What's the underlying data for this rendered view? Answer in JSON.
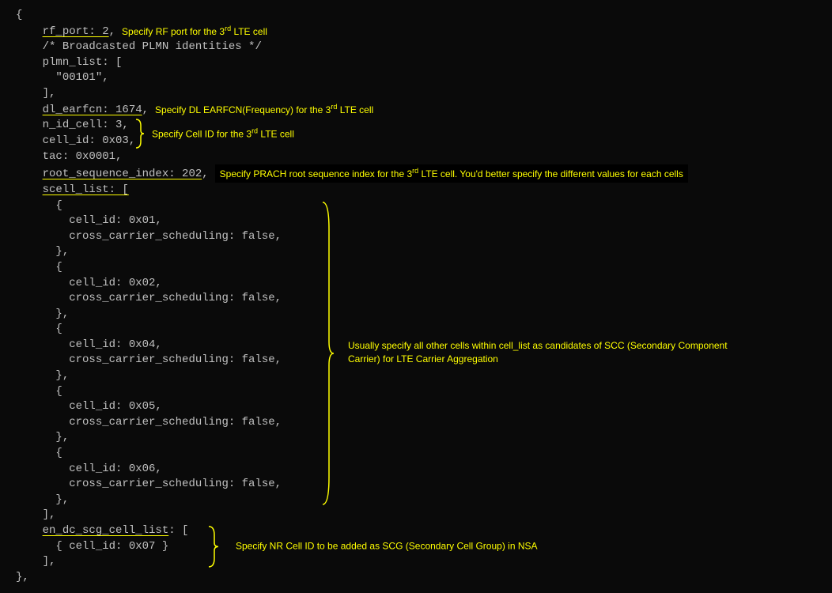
{
  "code": {
    "open_brace": "{",
    "rf_port_key": "rf_port: 2",
    "rf_port_comma": ",",
    "plmn_comment": "/* Broadcasted PLMN identities */",
    "plmn_list_open": "plmn_list: [",
    "plmn_value": "\"00101\",",
    "plmn_list_close": "],",
    "dl_earfcn_key": "dl_earfcn: 1674",
    "dl_earfcn_comma": ",",
    "n_id_cell": "n_id_cell: 3,",
    "cell_id": "cell_id: 0x03,",
    "tac": "tac: 0x0001,",
    "root_seq_key": "root_sequence_index: 202",
    "root_seq_comma": ",",
    "scell_open": "scell_list: [",
    "scell_item_open": "{",
    "scell_cellid_1": "cell_id: 0x01,",
    "scell_ccs": "cross_carrier_scheduling: false,",
    "scell_item_close": "},",
    "scell_cellid_2": "cell_id: 0x02,",
    "scell_cellid_4": "cell_id: 0x04,",
    "scell_cellid_5": "cell_id: 0x05,",
    "scell_cellid_6": "cell_id: 0x06,",
    "scell_close": "],",
    "en_dc_key": "en_dc_scg_cell_list",
    "en_dc_open": ": [",
    "en_dc_item": "{ cell_id: 0x07 }",
    "en_dc_close": "],",
    "close_brace": "},"
  },
  "annotations": {
    "rf_port": "Specify RF port for the 3",
    "rf_port_suffix": " LTE cell",
    "dl_earfcn": "Specify DL EARFCN(Frequency) for the 3",
    "dl_earfcn_suffix": " LTE cell",
    "cell_id": "Specify Cell ID for the 3",
    "cell_id_suffix": " LTE cell",
    "root_seq": "Specify PRACH root sequence index for the 3",
    "root_seq_suffix": " LTE cell. You'd better specify the different values for each cells",
    "scell": "Usually specify all other cells within cell_list as candidates of SCC (Secondary Component Carrier) for LTE Carrier Aggregation",
    "en_dc": "Specify NR Cell ID to be added as SCG (Secondary Cell Group) in NSA",
    "rd": "rd"
  }
}
